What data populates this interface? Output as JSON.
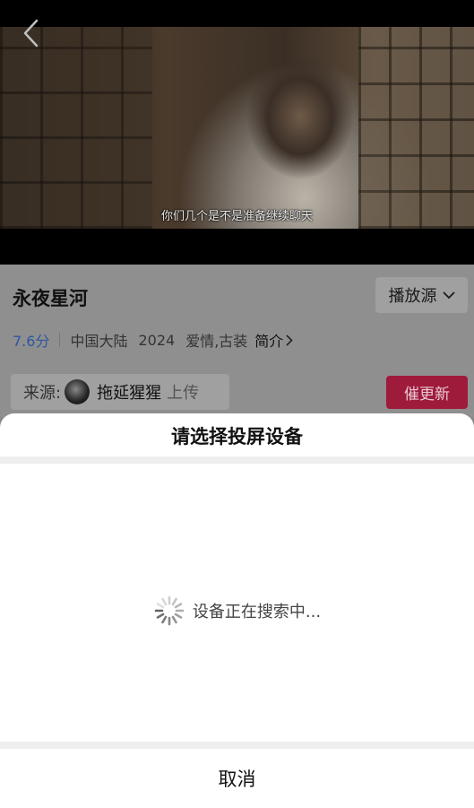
{
  "video": {
    "subtitle": "你们几个是不是准备继续聊天"
  },
  "show": {
    "title": "永夜星河",
    "source_button": "播放源",
    "score": "7.6分",
    "region": "中国大陆",
    "year": "2024",
    "genres": "爱情,古装",
    "intro_link": "简介"
  },
  "uploader": {
    "label": "来源:",
    "name": "拖延猩猩",
    "uploaded": "上传"
  },
  "urge_button": "催更新",
  "cast_sheet": {
    "title": "请选择投屏设备",
    "status": "设备正在搜索中...",
    "cancel": "取消"
  },
  "colors": {
    "accent_score": "#2f56a0",
    "urge_button_bg": "#9e1b3c"
  },
  "icons": {
    "back": "back-chevron-icon",
    "source_dropdown": "chevron-down-icon",
    "intro": "chevron-right-icon",
    "loading": "spinner-icon"
  }
}
